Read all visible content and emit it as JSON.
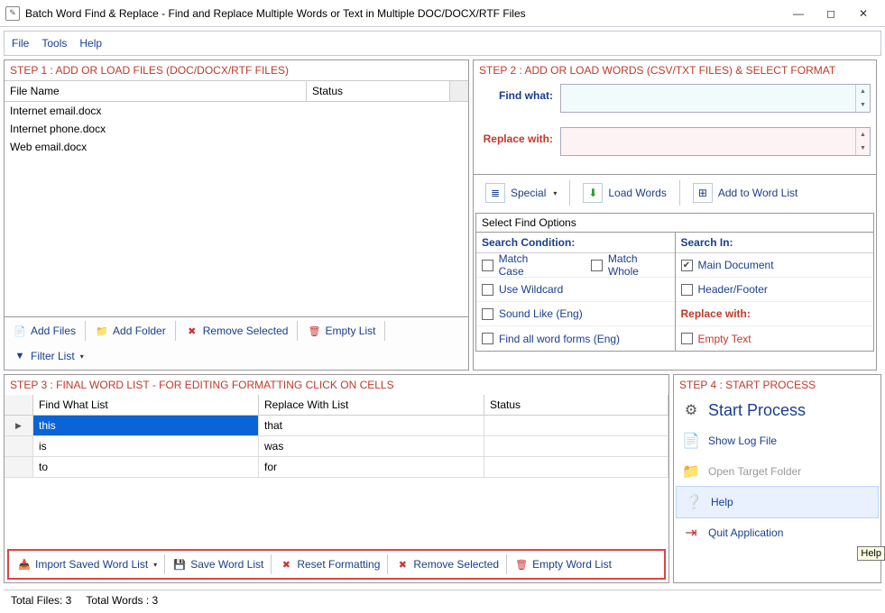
{
  "window": {
    "title": "Batch Word Find & Replace - Find and Replace Multiple Words or Text  in Multiple DOC/DOCX/RTF Files"
  },
  "menu": {
    "file": "File",
    "tools": "Tools",
    "help": "Help"
  },
  "step1": {
    "title": "STEP 1 : ADD OR LOAD FILES (DOC/DOCX/RTF FILES)",
    "col_filename": "File Name",
    "col_status": "Status",
    "rows": [
      "Internet email.docx",
      "Internet phone.docx",
      "Web email.docx"
    ],
    "btn_addfiles": "Add Files",
    "btn_addfolder": "Add Folder",
    "btn_removesel": "Remove Selected",
    "btn_emptylist": "Empty List",
    "btn_filterlist": "Filter List"
  },
  "step2": {
    "title": "STEP 2 : ADD OR LOAD WORDS (CSV/TXT FILES) & SELECT FORMAT",
    "find_label": "Find what:",
    "replace_label": "Replace with:",
    "btn_special": "Special",
    "btn_loadwords": "Load Words",
    "btn_addtolist": "Add to Word List",
    "opts_title": "Select Find Options",
    "col_search_cond": "Search Condition:",
    "col_search_in": "Search In:",
    "opt_matchcase": "Match Case",
    "opt_matchwhole": "Match Whole",
    "opt_wildcard": "Use Wildcard",
    "opt_soundlike": "Sound Like (Eng)",
    "opt_wordforms": "Find all word forms (Eng)",
    "opt_maindoc": "Main Document",
    "opt_headerfooter": "Header/Footer",
    "opt_replacewith": "Replace with:",
    "opt_emptytext": "Empty Text"
  },
  "step3": {
    "title": "STEP 3 : FINAL WORD LIST - FOR EDITING FORMATTING CLICK ON CELLS",
    "col_find": "Find What List",
    "col_replace": "Replace With List",
    "col_status": "Status",
    "rows": [
      {
        "find": "this",
        "replace": "that"
      },
      {
        "find": "is",
        "replace": "was"
      },
      {
        "find": "to",
        "replace": "for"
      }
    ],
    "btn_import": "Import Saved Word List",
    "btn_save": "Save Word List",
    "btn_reset": "Reset Formatting",
    "btn_removesel": "Remove Selected",
    "btn_empty": "Empty Word List"
  },
  "step4": {
    "title": "STEP 4 : START PROCESS",
    "btn_start": "Start Process",
    "btn_showlog": "Show Log File",
    "btn_opentarget": "Open Target Folder",
    "btn_help": "Help",
    "btn_quit": "Quit Application"
  },
  "status": {
    "total_files": "Total Files: 3",
    "total_words": "Total Words : 3"
  },
  "tooltip": "Help"
}
